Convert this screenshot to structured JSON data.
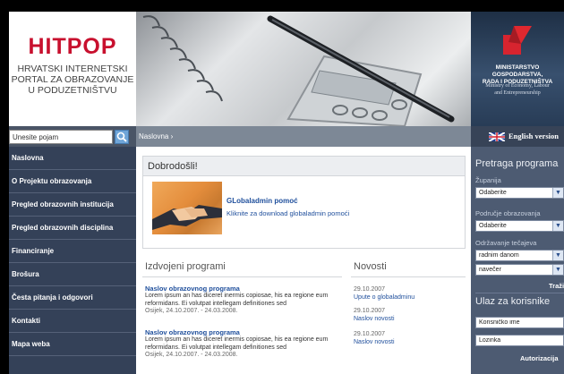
{
  "logo": {
    "title": "HITPOP",
    "subtitle_lines": [
      "HRVATSKI INTERNETSKI",
      "PORTAL ZA OBRAZOVANJE",
      "U PODUZETNIŠTVU"
    ]
  },
  "ministry": {
    "name_lines": [
      "MINISTARSTVO GOSPODARSTVA,",
      "RADA I PODUZETNIŠTVA"
    ],
    "name_en_lines": [
      "Ministry of Economy, Labour",
      "and Entrepreneurship"
    ]
  },
  "search": {
    "placeholder": "Unesite pojam"
  },
  "breadcrumb": "Naslovna  ›",
  "english_label": "English version",
  "nav": [
    "Naslovna",
    "O Projektu obrazovanja",
    "Pregled obrazovnih institucija",
    "Pregled obrazovnih disciplina",
    "Financiranje",
    "Brošura",
    "Česta pitanja i odgovori",
    "Kontakti",
    "Mapa weba"
  ],
  "welcome": {
    "title": "Dobrodošli!",
    "link": "GLobaladmin pomoć",
    "text": "Kliknite za download globaladmin pomoći"
  },
  "featured": {
    "title": "Izdvojeni programi",
    "items": [
      {
        "title": "Naslov obrazovnog programa",
        "desc": [
          "Lorem ipsum an has diceret inermis copiosae, his ea regione eum",
          "reformidans. Ei volutpat intellegam definitiones sed"
        ],
        "date": "Osijek, 24.10.2007. - 24.03.2008."
      },
      {
        "title": "Naslov obrazovnog programa",
        "desc": [
          "Lorem ipsum an has diceret inermis copiosae, his ea regione eum",
          "reformidans. Ei volutpat intellegam definitiones sed"
        ],
        "date": "Osijek, 24.10.2007. - 24.03.2008."
      }
    ]
  },
  "news": {
    "title": "Novosti",
    "items": [
      {
        "date": "29.10.2007",
        "title": "Upute o globaladminu"
      },
      {
        "date": "29.10.2007",
        "title": "Naslov novosti"
      },
      {
        "date": "29.10.2007",
        "title": "Naslov novosti"
      }
    ]
  },
  "program_search": {
    "title": "Pretraga programa",
    "zupanija_label": "Županija",
    "zupanija_value": "Odaberite",
    "podrucje_label": "Područje obrazovanja",
    "podrucje_value": "Odaberite",
    "odrzavanje_label": "Održavanje tečajeva",
    "odrzavanje_value1": "radnim danom",
    "odrzavanje_value2": "navečer",
    "search_button": "Traži"
  },
  "login": {
    "title": "Ulaz za korisnike",
    "username_placeholder": "Korisničko ime",
    "password_placeholder": "Lozinka",
    "button": "Autorizacija"
  },
  "colors": {
    "brand_red": "#c8102e",
    "sidebar": "#344158",
    "link": "#1f4f9c"
  }
}
